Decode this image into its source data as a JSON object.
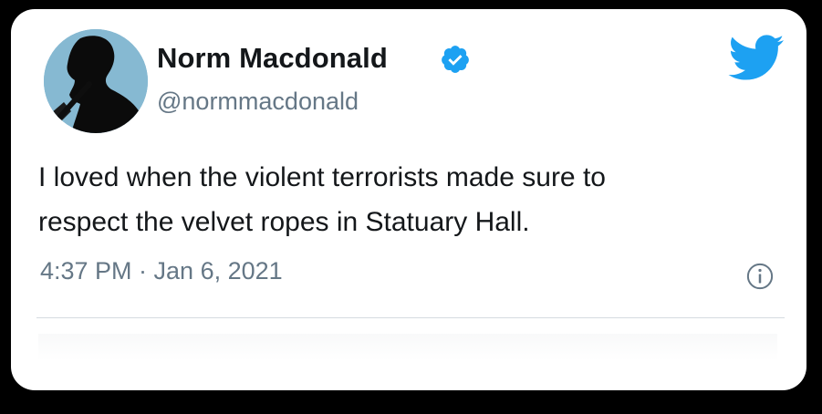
{
  "tweet": {
    "author": {
      "display_name": "Norm Macdonald",
      "handle": "@normmacdonald",
      "verified": true,
      "avatar_icon": "profile-photo"
    },
    "text_lines": [
      "I loved when the violent terrorists made sure to",
      "respect the velvet ropes in Statuary Hall."
    ],
    "timestamp": "4:37 PM · Jan 6, 2021",
    "icons": {
      "brand": "twitter-bird-icon",
      "verified": "verified-badge-icon",
      "info": "info-icon"
    },
    "colors": {
      "brand_blue": "#1da1f2",
      "text": "#14171a",
      "secondary_text": "#657786"
    }
  }
}
